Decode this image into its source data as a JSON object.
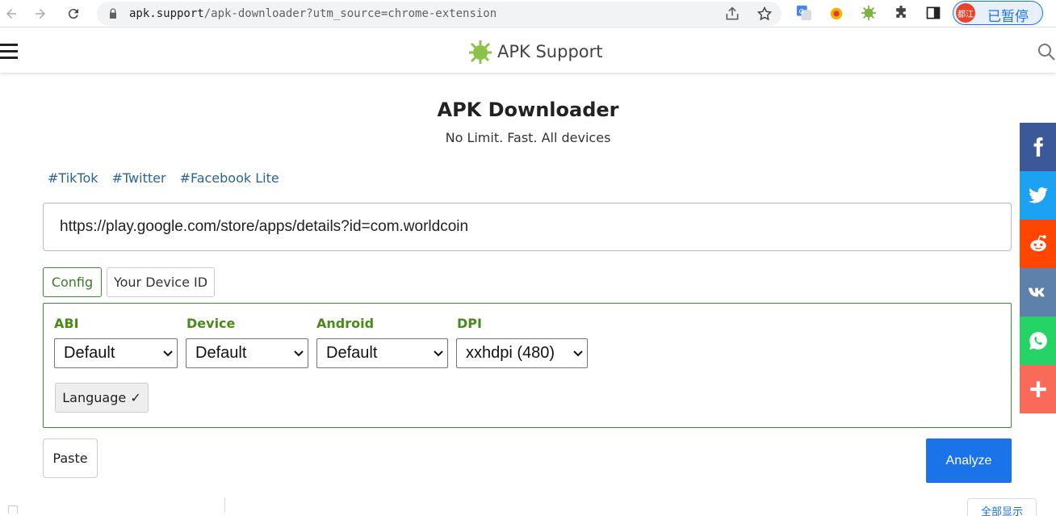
{
  "browser": {
    "url_host": "apk.support",
    "url_path": "/apk-downloader?utm_source=chrome-extension",
    "profile_avatar_text": "都江",
    "profile_status": "已暂停",
    "show_all_label": "全部显示"
  },
  "site": {
    "name": "APK Support",
    "brand_color": "#8bc34a"
  },
  "hero": {
    "title": "APK Downloader",
    "subtitle": "No Limit. Fast. All devices"
  },
  "tags": [
    "#TikTok",
    "#Twitter",
    "#Facebook Lite"
  ],
  "search": {
    "value": "https://play.google.com/store/apps/details?id=com.worldcoin"
  },
  "config_tabs": [
    {
      "label": "Config",
      "active": true
    },
    {
      "label": "Your Device ID",
      "active": false
    }
  ],
  "config": {
    "abi": {
      "label": "ABI",
      "value": "Default"
    },
    "device": {
      "label": "Device",
      "value": "Default"
    },
    "android": {
      "label": "Android",
      "value": "Default"
    },
    "dpi": {
      "label": "DPI",
      "value": "xxhdpi (480)"
    },
    "language_button": "Language ✓"
  },
  "actions": {
    "paste": "Paste",
    "analyze": "Analyze"
  },
  "share": [
    {
      "name": "facebook",
      "color": "#3b5998"
    },
    {
      "name": "twitter",
      "color": "#1da1f2"
    },
    {
      "name": "reddit",
      "color": "#ff4500"
    },
    {
      "name": "vk",
      "color": "#5d81ab"
    },
    {
      "name": "whatsapp",
      "color": "#25d366"
    },
    {
      "name": "more",
      "color": "#fa6a58"
    }
  ]
}
